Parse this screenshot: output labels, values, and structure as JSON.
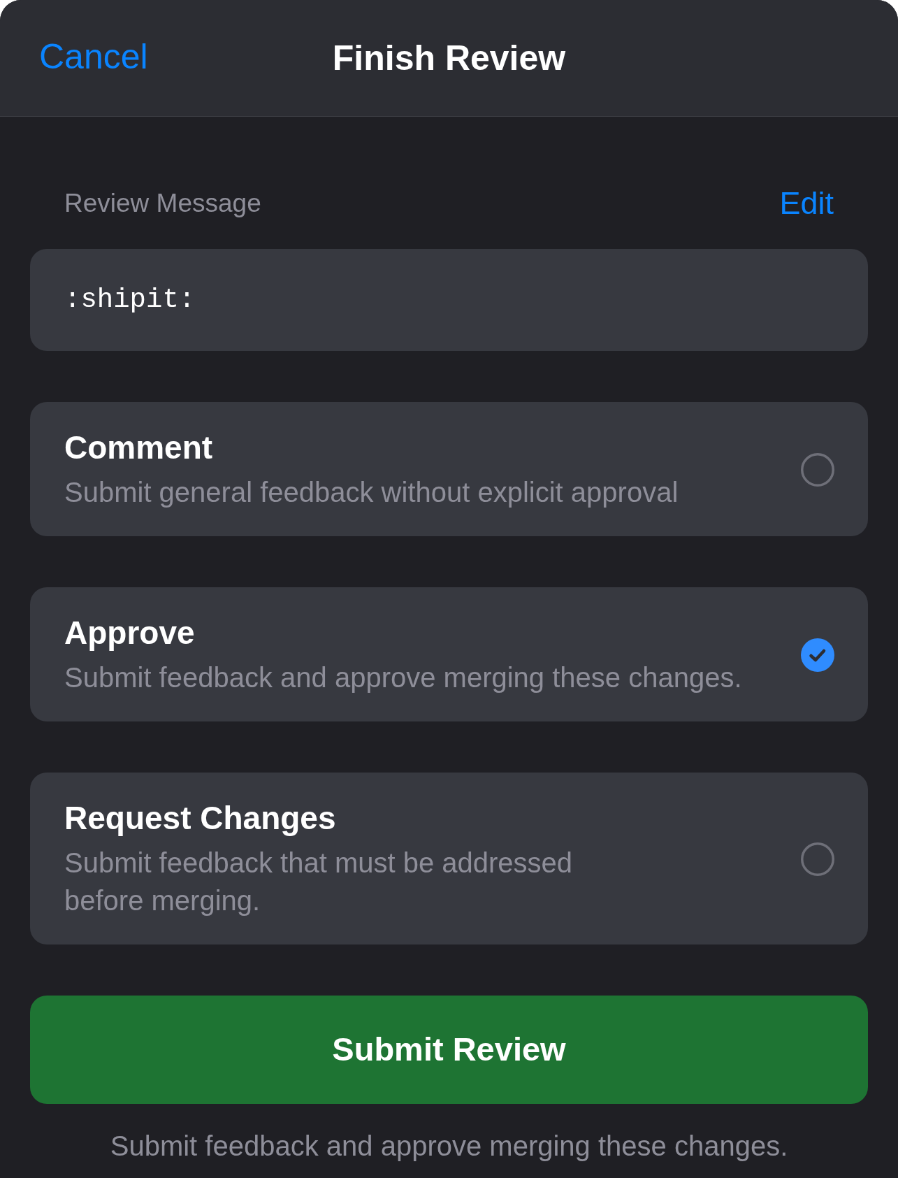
{
  "header": {
    "cancel": "Cancel",
    "title": "Finish Review"
  },
  "message": {
    "label": "Review Message",
    "edit": "Edit",
    "value": ":shipit:"
  },
  "options": [
    {
      "title": "Comment",
      "description": "Submit general feedback without explicit approval",
      "selected": false
    },
    {
      "title": "Approve",
      "description": "Submit feedback and approve merging these changes.",
      "selected": true
    },
    {
      "title": "Request Changes",
      "description": "Submit feedback that must be addressed\nbefore merging.",
      "selected": false
    }
  ],
  "submit": {
    "label": "Submit Review"
  },
  "footer_note": "Submit feedback and approve merging these changes."
}
